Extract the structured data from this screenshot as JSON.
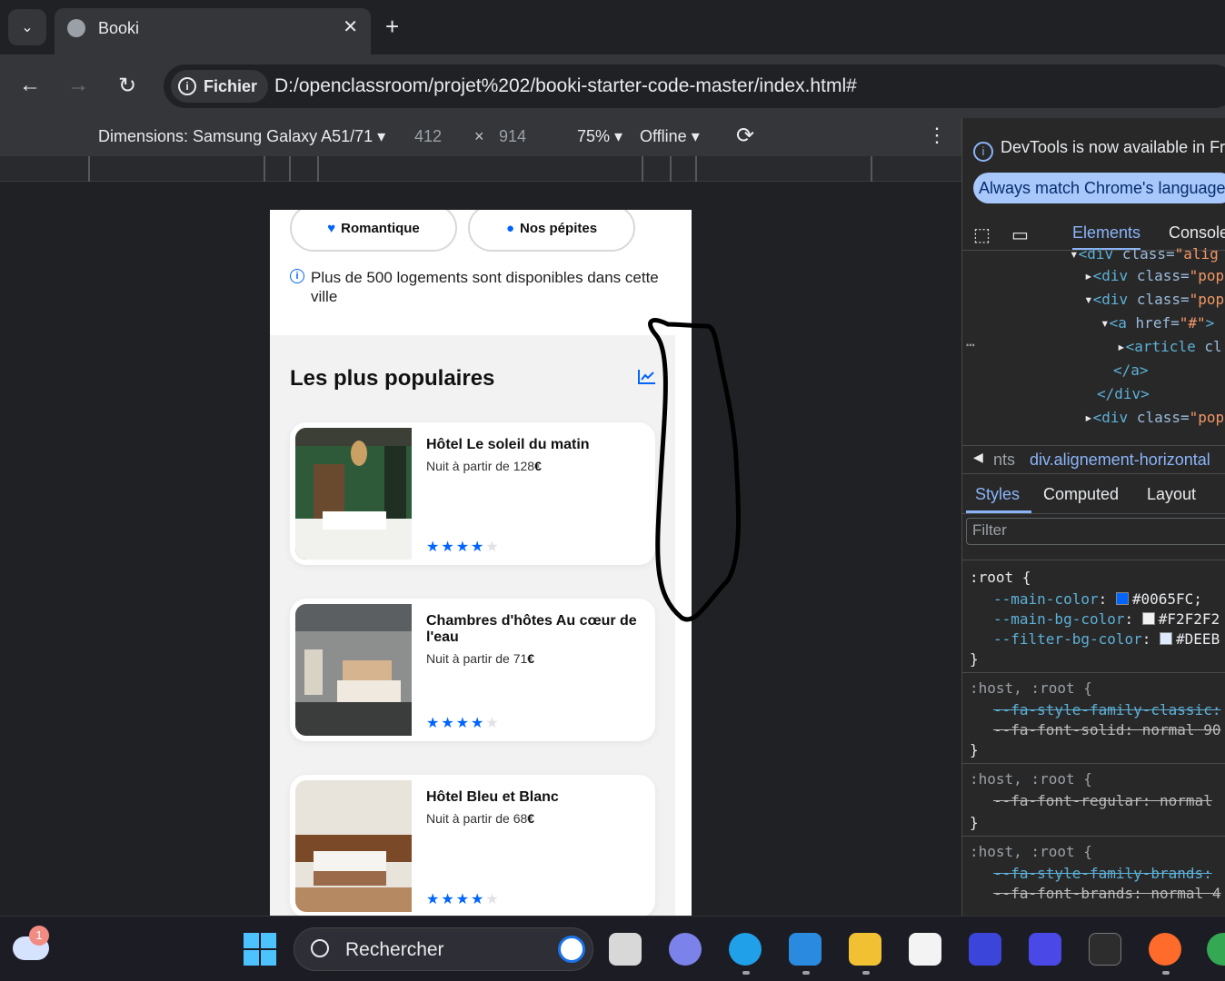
{
  "browser": {
    "tab_title": "Booki",
    "new_tab": "+",
    "security_chip": "Fichier",
    "url": "D:/openclassroom/projet%202/booki-starter-code-master/index.html#"
  },
  "device_toolbar": {
    "dimensions": "Dimensions: Samsung Galaxy A51/71",
    "width": "412",
    "times": "×",
    "height": "914",
    "zoom": "75%",
    "network": "Offline"
  },
  "page": {
    "filters": [
      "Romantique",
      "Nos pépites"
    ],
    "info_text": "Plus de 500 logements sont disponibles dans cette ville",
    "popular_title": "Les plus populaires",
    "cards": [
      {
        "name": "Hôtel Le soleil du matin",
        "price_prefix": "Nuit à partir de 128",
        "currency": "€",
        "rating": 4
      },
      {
        "name": "Chambres d'hôtes Au cœur de l'eau",
        "price_prefix": "Nuit à partir de 71",
        "currency": "€",
        "rating": 4
      },
      {
        "name": "Hôtel Bleu et Blanc",
        "price_prefix": "Nuit à partir de 68",
        "currency": "€",
        "rating": 4
      }
    ]
  },
  "devtools": {
    "notice": "DevTools is now available in Fre",
    "language_button": "Always match Chrome's language",
    "tabs": [
      "Elements",
      "Console"
    ],
    "crumb_prefix": "nts",
    "crumb": "div.alignement-horizontal",
    "subtabs": [
      "Styles",
      "Computed",
      "Layout"
    ],
    "filter_placeholder": "Filter",
    "root_selector": ":root {",
    "vars": [
      {
        "name": "--main-color",
        "value": "#0065FC;",
        "swatch": "#0065FC"
      },
      {
        "name": "--main-bg-color",
        "value": "#F2F2F2",
        "swatch": "#F2F2F2"
      },
      {
        "name": "--filter-bg-color",
        "value": "#DEEB",
        "swatch": "#DEEBFF"
      }
    ],
    "host_selector": ":host, :root {",
    "rule_text": [
      "--fa-style-family-classic:",
      "--fa-font-solid: normal 90",
      "--fa-font-regular: normal",
      "--fa-style-family-brands:",
      "--fa-font-brands: normal 4"
    ]
  },
  "taskbar": {
    "search_label": "Rechercher",
    "notification_count": "1"
  },
  "colors": {
    "main": "#0065FC",
    "main_bg": "#F2F2F2"
  }
}
